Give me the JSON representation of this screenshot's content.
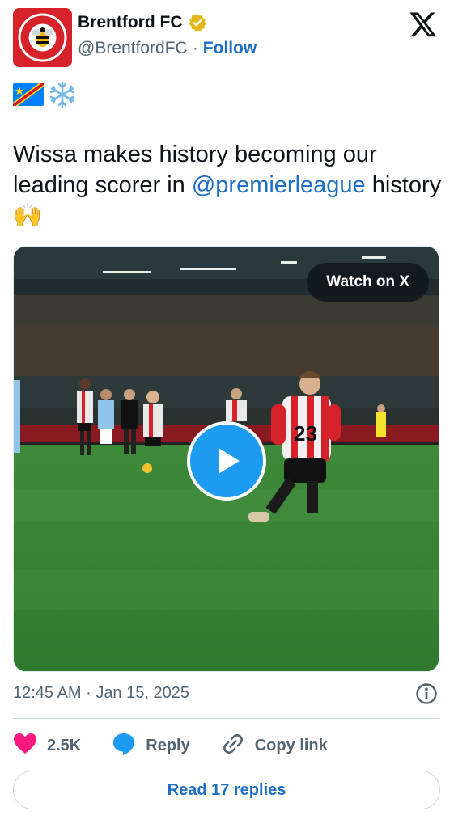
{
  "author": {
    "display_name": "Brentford FC",
    "handle": "@BrentfordFC",
    "separator": "·",
    "follow_label": "Follow",
    "avatar_text_top": "BRENTFORD",
    "avatar_text_bottom": "FOOTBALL CLUB",
    "verified_color": "#e2b719"
  },
  "emoji_line": [
    "flag-dr-congo-icon",
    "snowflake-icon"
  ],
  "tweet": {
    "text_before": "Wissa makes history becoming our leading scorer in ",
    "mention": "@premierleague",
    "text_after": " history 🙌"
  },
  "media": {
    "watch_label": "Watch on X",
    "play_icon": "play-icon",
    "shirt_number": "23"
  },
  "timestamp": {
    "time": "12:45 AM",
    "separator": "·",
    "date": "Jan 15, 2025"
  },
  "actions": {
    "likes_count": "2.5K",
    "reply_label": "Reply",
    "copy_link_label": "Copy link"
  },
  "read_replies_label": "Read 17 replies",
  "colors": {
    "link_blue": "#1d70c2",
    "like_pink": "#f91880",
    "reply_blue": "#1d9bf0",
    "text_grey": "#536471"
  }
}
